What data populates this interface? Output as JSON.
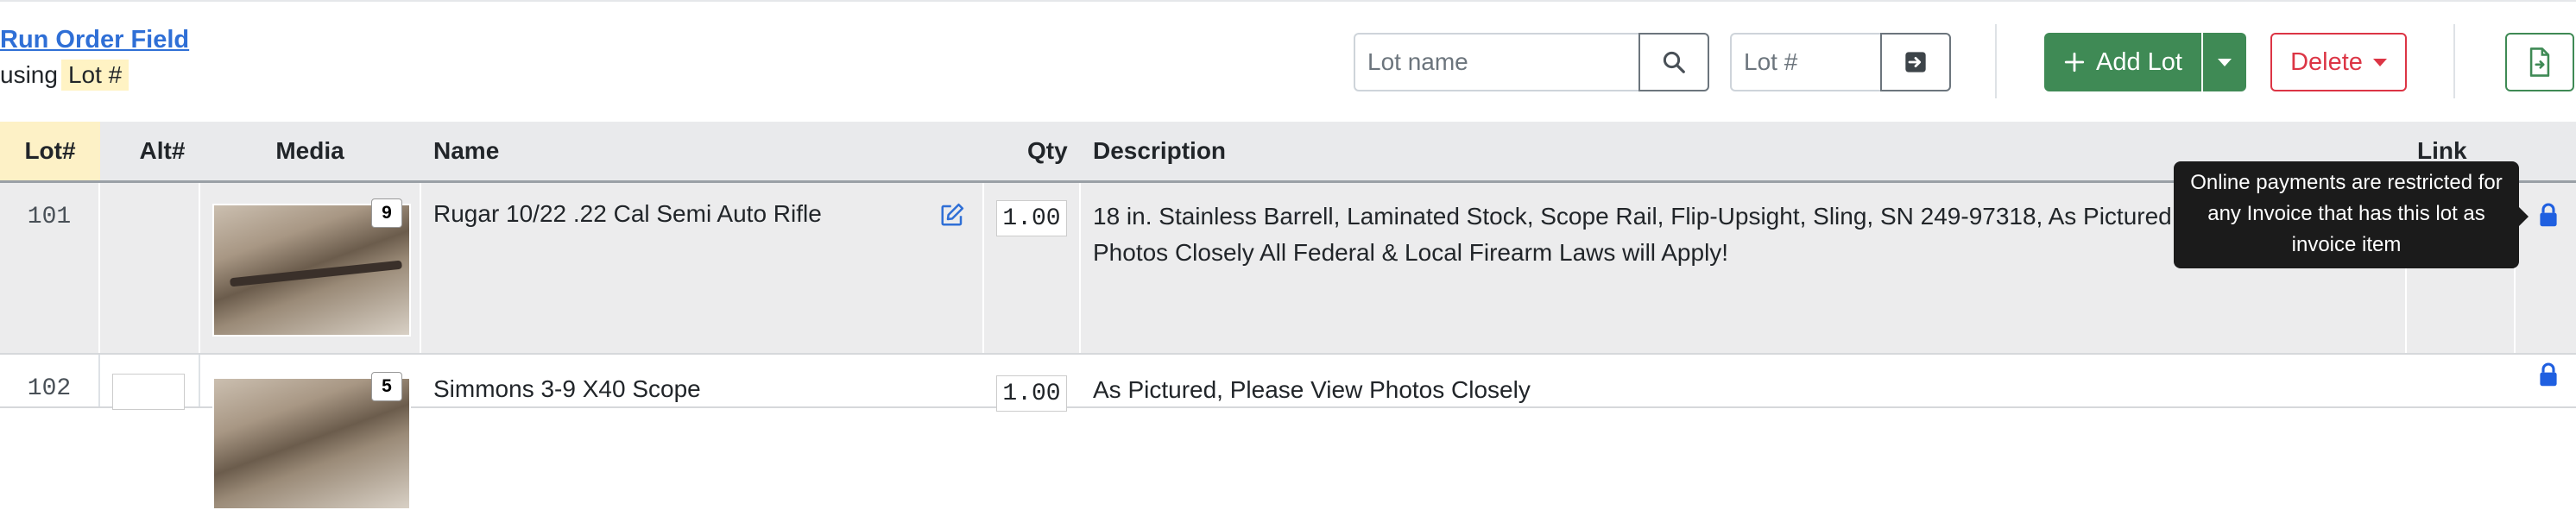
{
  "header": {
    "run_order_link": "Run Order Field",
    "using_label": "using",
    "using_value": "Lot #"
  },
  "search": {
    "lot_name_placeholder": "Lot name",
    "lot_number_placeholder": "Lot #"
  },
  "toolbar": {
    "add_lot_label": "Add Lot",
    "delete_label": "Delete",
    "colors": {
      "success": "#3f8a55",
      "danger": "#dc3545",
      "link": "#2f6fd6"
    }
  },
  "table": {
    "columns": {
      "lot": "Lot#",
      "alt": "Alt#",
      "media": "Media",
      "name": "Name",
      "qty": "Qty",
      "description": "Description",
      "link": "Link"
    },
    "rows": [
      {
        "lot": "101",
        "alt": "",
        "media_count": "9",
        "name": "Rugar 10/22 .22 Cal Semi Auto Rifle",
        "qty": "1.00",
        "description": "18 in. Stainless Barrell, Laminated Stock, Scope Rail, Flip-Upsight, Sling, SN 249-97318, As Pictured, Please View Photos Closely All Federal & Local Firearm Laws will Apply!"
      },
      {
        "lot": "102",
        "alt": "",
        "media_count": "5",
        "name": "Simmons 3-9 X40 Scope",
        "qty": "1.00",
        "description": "As Pictured, Please View Photos Closely"
      }
    ]
  },
  "tooltip": {
    "text": "Online payments are restricted for any Invoice that has this lot as invoice item"
  },
  "icons": {
    "search": "search-icon",
    "go": "arrow-right-square-icon",
    "add": "plus-icon",
    "export": "file-export-icon",
    "edit": "pencil-square-icon",
    "lock": "lock-icon"
  }
}
